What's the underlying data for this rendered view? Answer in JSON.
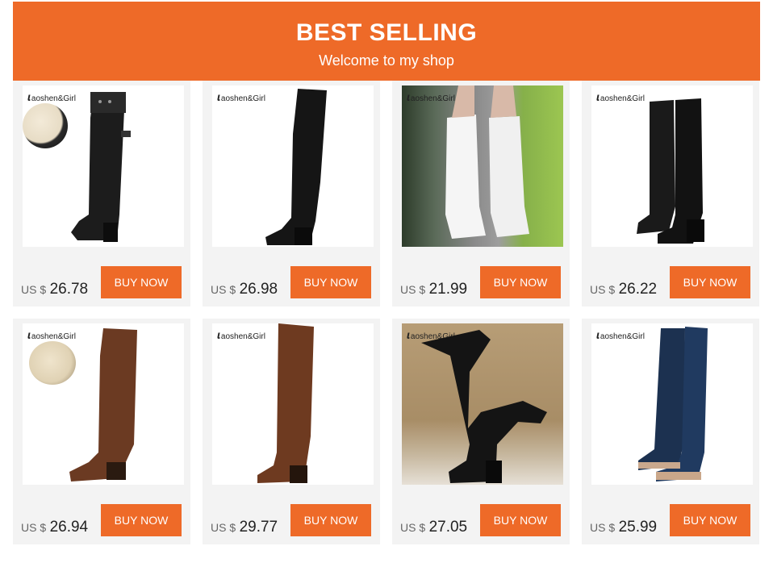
{
  "banner": {
    "title": "BEST SELLING",
    "subtitle": "Welcome to my shop"
  },
  "products": [
    {
      "brand": "aoshen&Girl",
      "currency": "US $",
      "price": "26.78",
      "button": "BUY NOW"
    },
    {
      "brand": "aoshen&Girl",
      "currency": "US $",
      "price": "26.98",
      "button": "BUY NOW"
    },
    {
      "brand": "aoshen&Girl",
      "currency": "US $",
      "price": "21.99",
      "button": "BUY NOW"
    },
    {
      "brand": "aoshen&Girl",
      "currency": "US $",
      "price": "26.22",
      "button": "BUY NOW"
    },
    {
      "brand": "aoshen&Girl",
      "currency": "US $",
      "price": "26.94",
      "button": "BUY NOW"
    },
    {
      "brand": "aoshen&Girl",
      "currency": "US $",
      "price": "29.77",
      "button": "BUY NOW"
    },
    {
      "brand": "aoshen&Girl",
      "currency": "US $",
      "price": "27.05",
      "button": "BUY NOW"
    },
    {
      "brand": "aoshen&Girl",
      "currency": "US $",
      "price": "25.99",
      "button": "BUY NOW"
    }
  ],
  "colors": {
    "accent": "#ee6a28",
    "card_bg": "#f3f3f3"
  }
}
